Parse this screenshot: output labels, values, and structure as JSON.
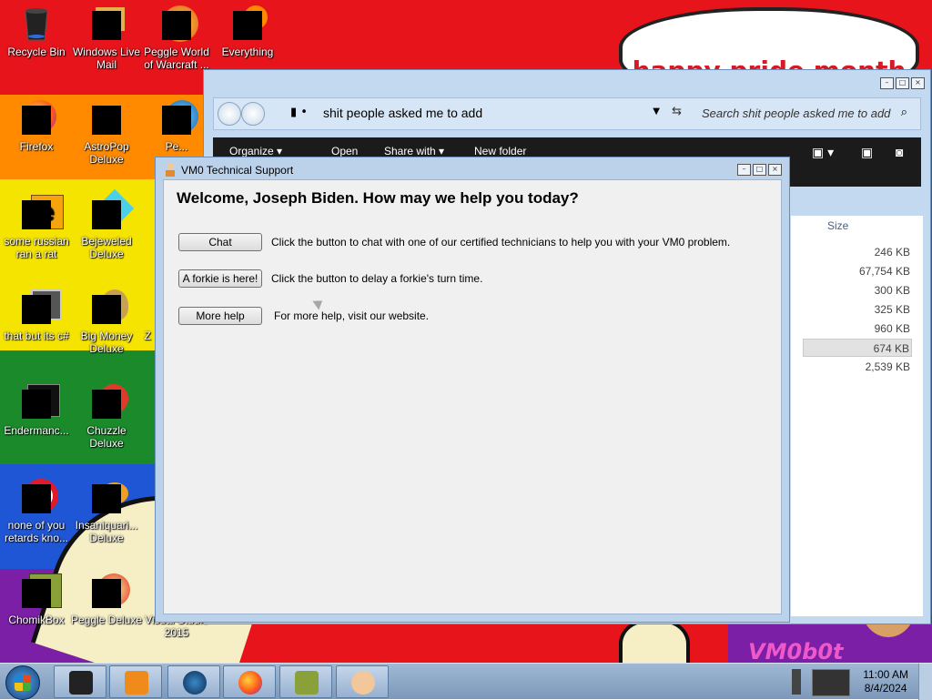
{
  "wallpaper": {
    "speech_text": "happy pride month",
    "logo_text": "VM0b0t",
    "colors": [
      "#e8141c",
      "#ff8a00",
      "#f5e300",
      "#1a8a2a",
      "#1f56d6",
      "#7a1fa6"
    ]
  },
  "desktop_icons": [
    {
      "label": "Recycle Bin",
      "icon": "recycle-bin-icon"
    },
    {
      "label": "Windows Live Mail",
      "icon": "windows-live-mail-icon"
    },
    {
      "label": "Peggle World of Warcraft ...",
      "icon": "peggle-wow-icon"
    },
    {
      "label": "Everything",
      "icon": "everything-search-icon"
    },
    {
      "label": "Firefox",
      "icon": "firefox-icon"
    },
    {
      "label": "AstroPop Deluxe",
      "icon": "astropop-icon"
    },
    {
      "label": "Pe...",
      "icon": "peggle-nights-icon"
    },
    {
      "label": "some russian ran a rat",
      "icon": "shortcut-e-icon"
    },
    {
      "label": "Bejeweled Deluxe",
      "icon": "bejeweled-icon"
    },
    {
      "label": "that but its c#",
      "icon": "shortcut-stack-icon"
    },
    {
      "label": "Big Money Deluxe",
      "icon": "big-money-icon"
    },
    {
      "label": "Z",
      "icon": "zuma-icon"
    },
    {
      "label": "Endermanc...",
      "icon": "endermanch-icon"
    },
    {
      "label": "Chuzzle Deluxe",
      "icon": "chuzzle-icon"
    },
    {
      "label": "none of you retards kno...",
      "icon": "opera-icon"
    },
    {
      "label": "Insaniquari... Deluxe",
      "icon": "insaniquarium-icon"
    },
    {
      "label": "ChomikBox",
      "icon": "chomikbox-icon"
    },
    {
      "label": "Peggle Deluxe",
      "icon": "peggle-deluxe-icon"
    },
    {
      "label": "Visual Studio 2015",
      "icon": "visual-studio-icon"
    }
  ],
  "explorer": {
    "path": "shit people asked me to add",
    "search_placeholder": "Search shit people asked me to add",
    "toolbar": [
      "Organize ▾",
      "Open",
      "Share with ▾",
      "New folder"
    ],
    "column_header": "Size",
    "sizes": [
      "246 KB",
      "67,754 KB",
      "300 KB",
      "325 KB",
      "960 KB",
      "674 KB",
      "2,539 KB"
    ],
    "selected_index": 5
  },
  "support": {
    "title": "VM0 Technical Support",
    "welcome": "Welcome, Joseph Biden. How may we help you today?",
    "rows": [
      {
        "button": "Chat",
        "text": "Click the button to chat with one of our certified technicians to help you with your VM0 problem."
      },
      {
        "button": "A forkie is here!",
        "text": "Click the button to delay a forkie's turn time."
      },
      {
        "button": "More help",
        "text": "For more help, visit our website."
      }
    ]
  },
  "taskbar": {
    "items": [
      "window-manager-icon",
      "media-player-icon",
      "orb-icon",
      "firefox-icon",
      "chomikbox-icon",
      "support-agent-icon"
    ],
    "time": "11:00 AM",
    "date": "8/4/2024"
  }
}
